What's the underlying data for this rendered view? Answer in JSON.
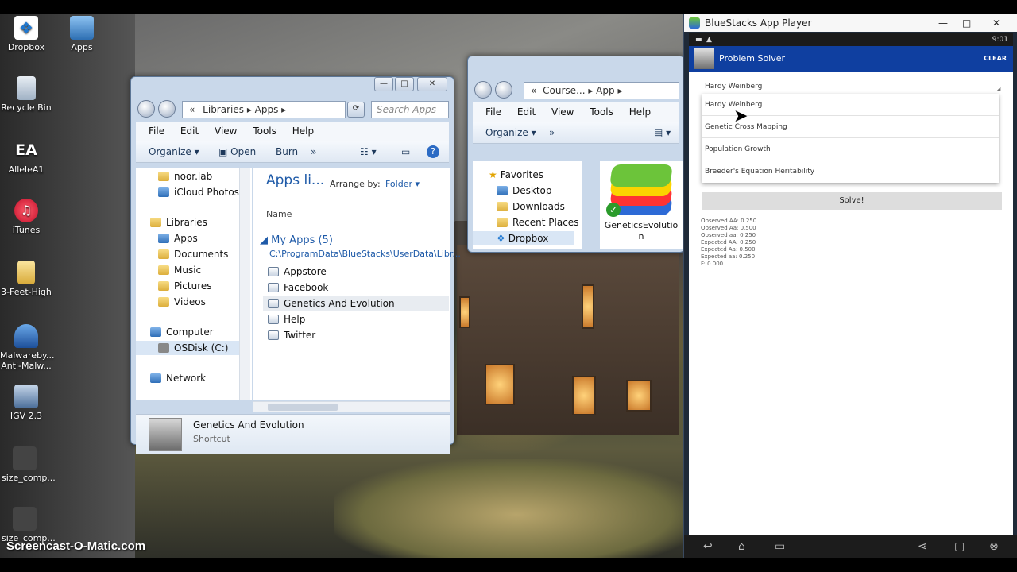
{
  "desktop": {
    "icons": [
      {
        "label": "Dropbox"
      },
      {
        "label": "Apps"
      },
      {
        "label": "Recycle Bin"
      },
      {
        "label": "AlleleA1",
        "badge": "EA"
      },
      {
        "label": "iTunes"
      },
      {
        "label": "3-Feet-High"
      },
      {
        "label": "Malwareby... Anti-Malw..."
      },
      {
        "label": "IGV 2.3"
      },
      {
        "label": "size_comp..."
      },
      {
        "label": "size_comp..."
      }
    ],
    "watermark": "Screencast-O-Matic.com"
  },
  "explorer1": {
    "breadcrumb": [
      "«",
      "Libraries",
      "Apps"
    ],
    "search_placeholder": "Search Apps",
    "menu": [
      "File",
      "Edit",
      "View",
      "Tools",
      "Help"
    ],
    "commands": [
      "Organize ▾",
      "Open",
      "Burn",
      "»"
    ],
    "nav_tree": [
      "noor.lab",
      "iCloud Photos",
      "Libraries",
      "Apps",
      "Documents",
      "Music",
      "Pictures",
      "Videos",
      "Computer",
      "OSDisk (C:)",
      "Network"
    ],
    "library_title": "Apps li...",
    "arrange_by_label": "Arrange by:",
    "arrange_by_value": "Folder ▾",
    "column_name": "Name",
    "group_title": "My Apps (5)",
    "group_path": "C:\\ProgramData\\BlueStacks\\UserData\\Libr...",
    "files": [
      "Appstore",
      "Facebook",
      "Genetics And Evolution",
      "Help",
      "Twitter"
    ],
    "selected_file": "Genetics And Evolution",
    "details_name": "Genetics And Evolution",
    "details_type": "Shortcut"
  },
  "explorer2": {
    "breadcrumb": [
      "«",
      "Course...",
      "App"
    ],
    "menu": [
      "File",
      "Edit",
      "View",
      "Tools",
      "Help"
    ],
    "commands": [
      "Organize ▾",
      "»"
    ],
    "nav_tree": [
      "Favorites",
      "Desktop",
      "Downloads",
      "Recent Places",
      "Dropbox"
    ],
    "file_label": "GeneticsEvolutio n"
  },
  "bluestacks": {
    "window_title": "BlueStacks App Player",
    "clock": "9:01",
    "app_title": "Problem Solver",
    "clear_label": "CLEAR",
    "spinner_value": "Hardy Weinberg",
    "dropdown_options": [
      "Hardy Weinberg",
      "Genetic Cross Mapping",
      "Population Growth",
      "Breeder's Equation Heritability"
    ],
    "solve_label": "Solve!",
    "results": [
      "Observed AA: 0.250",
      "Observed Aa: 0.500",
      "Observed aa: 0.250",
      "Expected AA: 0.250",
      "Expected Aa: 0.500",
      "Expected aa: 0.250",
      "F: 0.000"
    ]
  }
}
